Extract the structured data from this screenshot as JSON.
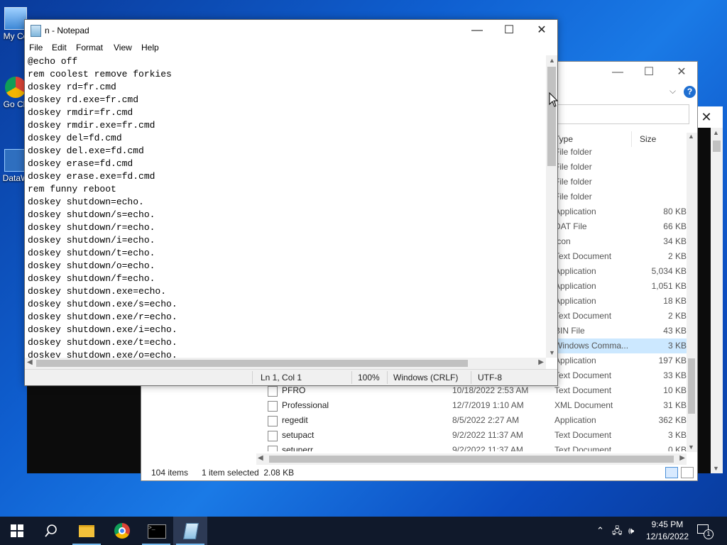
{
  "desktop": {
    "icons": [
      {
        "label": "My Co",
        "icon": "computer-icon"
      },
      {
        "label": "Go Ch",
        "icon": "chrome-icon"
      },
      {
        "label": "DataW",
        "icon": "app-icon"
      }
    ]
  },
  "notepad": {
    "title": "n - Notepad",
    "menu": [
      "File",
      "Edit",
      "Format",
      "View",
      "Help"
    ],
    "lines": [
      "@echo off",
      "rem coolest remove forkies",
      "doskey rd=fr.cmd",
      "doskey rd.exe=fr.cmd",
      "doskey rmdir=fr.cmd",
      "doskey rmdir.exe=fr.cmd",
      "doskey del=fd.cmd",
      "doskey del.exe=fd.cmd",
      "doskey erase=fd.cmd",
      "doskey erase.exe=fd.cmd",
      "rem funny reboot",
      "doskey shutdown=echo.",
      "doskey shutdown/s=echo.",
      "doskey shutdown/r=echo.",
      "doskey shutdown/i=echo.",
      "doskey shutdown/t=echo.",
      "doskey shutdown/o=echo.",
      "doskey shutdown/f=echo.",
      "doskey shutdown.exe=echo.",
      "doskey shutdown.exe/s=echo.",
      "doskey shutdown.exe/r=echo.",
      "doskey shutdown.exe/i=echo.",
      "doskey shutdown.exe/t=echo.",
      "doskey shutdown.exe/o=echo."
    ],
    "status": {
      "position": "Ln 1, Col 1",
      "zoom": "100%",
      "line_ending": "Windows (CRLF)",
      "encoding": "UTF-8"
    }
  },
  "explorer": {
    "columns": {
      "type": "Type",
      "size": "Size"
    },
    "rows": [
      {
        "name": "",
        "date": "",
        "type": "File folder",
        "size": "",
        "selected": false
      },
      {
        "name": "",
        "date": "",
        "type": "File folder",
        "size": "",
        "selected": false
      },
      {
        "name": "",
        "date": "",
        "type": "File folder",
        "size": "",
        "selected": false
      },
      {
        "name": "",
        "date": "",
        "type": "File folder",
        "size": "",
        "selected": false
      },
      {
        "name": "",
        "date": "",
        "type": "Application",
        "size": "80 KB",
        "selected": false
      },
      {
        "name": "",
        "date": "",
        "type": "DAT File",
        "size": "66 KB",
        "selected": false
      },
      {
        "name": "",
        "date": "",
        "type": "Icon",
        "size": "34 KB",
        "selected": false
      },
      {
        "name": "",
        "date": "",
        "type": "Text Document",
        "size": "2 KB",
        "selected": false
      },
      {
        "name": "",
        "date": "",
        "type": "Application",
        "size": "5,034 KB",
        "selected": false
      },
      {
        "name": "",
        "date": "",
        "type": "Application",
        "size": "1,051 KB",
        "selected": false
      },
      {
        "name": "",
        "date": "",
        "type": "Application",
        "size": "18 KB",
        "selected": false
      },
      {
        "name": "",
        "date": "",
        "type": "Text Document",
        "size": "2 KB",
        "selected": false
      },
      {
        "name": "",
        "date": "",
        "type": "BIN File",
        "size": "43 KB",
        "selected": false
      },
      {
        "name": "",
        "date": "",
        "type": "Windows Comma...",
        "size": "3 KB",
        "selected": true
      },
      {
        "name": "",
        "date": "",
        "type": "Application",
        "size": "197 KB",
        "selected": false
      },
      {
        "name": "",
        "date": "",
        "type": "Text Document",
        "size": "33 KB",
        "selected": false
      },
      {
        "name": "PFRO",
        "date": "10/18/2022 2:53 AM",
        "type": "Text Document",
        "size": "10 KB",
        "selected": false
      },
      {
        "name": "Professional",
        "date": "12/7/2019 1:10 AM",
        "type": "XML Document",
        "size": "31 KB",
        "selected": false
      },
      {
        "name": "regedit",
        "date": "8/5/2022 2:27 AM",
        "type": "Application",
        "size": "362 KB",
        "selected": false
      },
      {
        "name": "setupact",
        "date": "9/2/2022 11:37 AM",
        "type": "Text Document",
        "size": "3 KB",
        "selected": false
      },
      {
        "name": "setuperr",
        "date": "9/2/2022 11:37 AM",
        "type": "Text Document",
        "size": "0 KB",
        "selected": false
      }
    ],
    "status": {
      "items": "104 items",
      "selected": "1 item selected  2.08 KB"
    }
  },
  "taskbar": {
    "time": "9:45 PM",
    "date": "12/16/2022",
    "notifications": "1"
  },
  "colors": {
    "accent": "#0078d7",
    "selected_row": "#cce8ff",
    "taskbar": "#10192b"
  }
}
